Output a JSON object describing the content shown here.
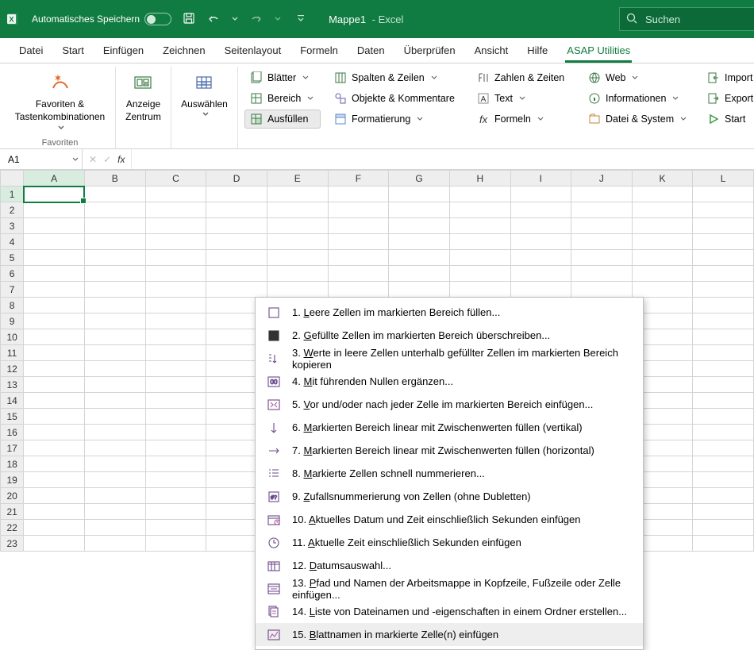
{
  "titlebar": {
    "autosave_label": "Automatisches Speichern",
    "doc_name": "Mappe1",
    "doc_app": "  -  Excel",
    "search_placeholder": "Suchen"
  },
  "tabs": [
    "Datei",
    "Start",
    "Einfügen",
    "Zeichnen",
    "Seitenlayout",
    "Formeln",
    "Daten",
    "Überprüfen",
    "Ansicht",
    "Hilfe",
    "ASAP Utilities"
  ],
  "active_tab": 10,
  "ribbon": {
    "favorites_line1": "Favoriten &",
    "favorites_line2": "Tastenkombinationen",
    "favorites_group": "Favoriten",
    "anzeige_line1": "Anzeige",
    "anzeige_line2": "Zentrum",
    "auswaehlen": "Auswählen",
    "col1": {
      "a": "Blätter",
      "b": "Bereich",
      "c": "Ausfüllen"
    },
    "col2": {
      "a": "Spalten & Zeilen",
      "b": "Objekte & Kommentare",
      "c": "Formatierung"
    },
    "col3": {
      "a": "Zahlen & Zeiten",
      "b": "Text",
      "c": "Formeln"
    },
    "col4": {
      "a": "Web",
      "b": "Informationen",
      "c": "Datei & System"
    },
    "col5": {
      "a": "Import",
      "b": "Export",
      "c": "Start"
    }
  },
  "namebox": "A1",
  "columns": [
    "A",
    "B",
    "C",
    "D",
    "E",
    "F",
    "G",
    "H",
    "I",
    "J",
    "K",
    "L"
  ],
  "rows_count": 23,
  "menu": {
    "items": [
      "Leere Zellen im markierten Bereich füllen...",
      "Gefüllte Zellen im markierten Bereich überschreiben...",
      "Werte in leere Zellen unterhalb gefüllter Zellen im markierten Bereich kopieren",
      "Mit führenden Nullen ergänzen...",
      "Vor und/oder nach jeder Zelle im markierten Bereich einfügen...",
      "Markierten Bereich linear mit Zwischenwerten füllen (vertikal)",
      "Markierten Bereich linear mit Zwischenwerten füllen (horizontal)",
      "Markierte Zellen schnell nummerieren...",
      "Zufallsnummerierung von Zellen (ohne Dubletten)",
      "Aktuelles Datum und Zeit einschließlich Sekunden einfügen",
      "Aktuelle Zeit einschließlich Sekunden einfügen",
      "Datumsauswahl...",
      "Pfad und Namen der Arbeitsmappe in Kopfzeile, Fußzeile oder Zelle einfügen...",
      "Liste von Dateinamen und -eigenschaften in einem Ordner erstellen...",
      "Blattnamen in markierte Zelle(n) einfügen"
    ],
    "hover_index": 14
  }
}
